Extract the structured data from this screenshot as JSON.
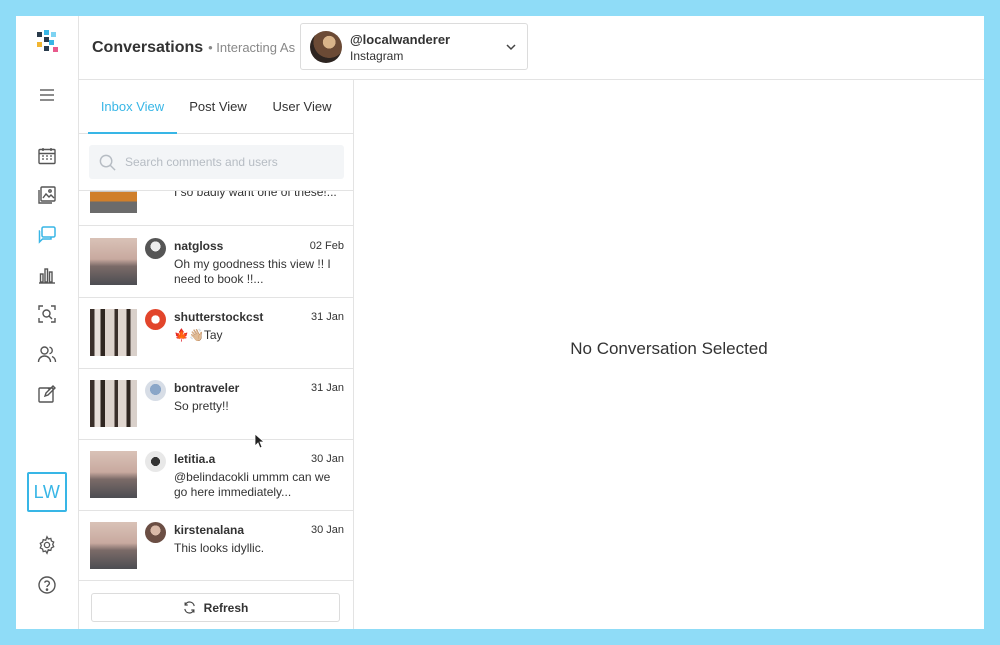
{
  "header": {
    "title": "Conversations",
    "interacting_as": "• Interacting As",
    "account": {
      "handle": "@localwanderer",
      "network": "Instagram"
    }
  },
  "rail": {
    "items": [
      {
        "name": "menu-icon"
      },
      {
        "name": "calendar-icon"
      },
      {
        "name": "media-icon"
      },
      {
        "name": "conversations-icon",
        "active": true
      },
      {
        "name": "analytics-icon"
      },
      {
        "name": "discover-icon"
      },
      {
        "name": "people-icon"
      },
      {
        "name": "compose-icon"
      }
    ],
    "user_initials": "LW"
  },
  "tabs": [
    {
      "label": "Inbox View",
      "active": true
    },
    {
      "label": "Post View",
      "active": false
    },
    {
      "label": "User View",
      "active": false
    }
  ],
  "search": {
    "placeholder": "Search comments and users"
  },
  "conversations": [
    {
      "user": "",
      "date": "",
      "text": "I so badly want one of these!...",
      "thumb": "van"
    },
    {
      "user": "natgloss",
      "date": "02 Feb",
      "text": "Oh my goodness this view !! I need to book !!...",
      "thumb": "sunset"
    },
    {
      "user": "shutterstockcst",
      "date": "31 Jan",
      "text": "🍁👋🏼Tay",
      "thumb": "forest"
    },
    {
      "user": "bontraveler",
      "date": "31 Jan",
      "text": "So pretty!!",
      "thumb": "forest"
    },
    {
      "user": "letitia.a",
      "date": "30 Jan",
      "text": "@belindacokli ummm can we go here immediately...",
      "thumb": "sunset"
    },
    {
      "user": "kirstenalana",
      "date": "30 Jan",
      "text": "This looks idyllic.",
      "thumb": "sunset"
    }
  ],
  "refresh_label": "Refresh",
  "detail": {
    "empty_message": "No Conversation Selected"
  },
  "colors": {
    "accent": "#38b6e6",
    "background": "#8fdcf7"
  }
}
